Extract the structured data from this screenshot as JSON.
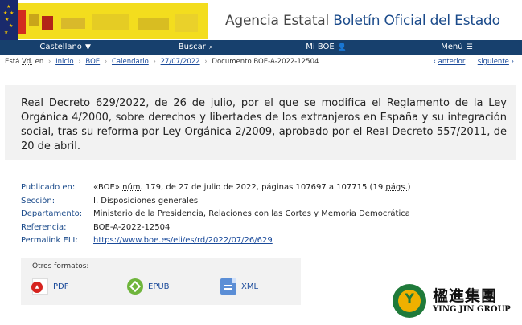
{
  "header": {
    "title_plain": "Agencia Estatal",
    "title_accent": "Boletín Oficial del Estado"
  },
  "nav": {
    "items": [
      {
        "label": "Castellano",
        "icon": "chevron-down-icon",
        "glyph": "▼"
      },
      {
        "label": "Buscar",
        "icon": "search-icon",
        "glyph": "⌕"
      },
      {
        "label": "Mi BOE",
        "icon": "user-icon",
        "glyph": "👤"
      },
      {
        "label": "Menú",
        "icon": "menu-icon",
        "glyph": "☰"
      }
    ]
  },
  "breadcrumb": {
    "prefix": "Está",
    "prefix_abbr": "Vd.",
    "prefix_suffix": "en",
    "items": [
      "Inicio",
      "BOE",
      "Calendario",
      "27/07/2022"
    ],
    "current": "Documento BOE-A-2022-12504",
    "separator": "›"
  },
  "pager": {
    "prev_glyph": "‹",
    "prev": "anterior",
    "next": "siguiente",
    "next_glyph": "›"
  },
  "document": {
    "title": "Real Decreto 629/2022, de 26 de julio, por el que se modifica el Reglamento de la Ley Orgánica 4/2000, sobre derechos y libertades de los extranjeros en España y su integración social, tras su reforma por Ley Orgánica 2/2009, aprobado por el Real Decreto 557/2011, de 20 de abril."
  },
  "metadata": {
    "published_label": "Publicado en:",
    "published_boe": "«BOE»",
    "published_num_abbr": "núm.",
    "published_rest": "179, de 27 de julio de 2022, páginas 107697 a 107715 (19",
    "published_pags_abbr": "págs.",
    "published_close": ")",
    "section_label": "Sección:",
    "section_value": "I. Disposiciones generales",
    "department_label": "Departamento:",
    "department_value": "Ministerio de la Presidencia, Relaciones con las Cortes y Memoria Democrática",
    "reference_label": "Referencia:",
    "reference_value": "BOE-A-2022-12504",
    "permalink_label": "Permalink ELI:",
    "permalink_value": "https://www.boe.es/eli/es/rd/2022/07/26/629"
  },
  "formats": {
    "heading": "Otros formatos:",
    "items": [
      {
        "label": "PDF",
        "icon": "pdf-icon"
      },
      {
        "label": "EPUB",
        "icon": "epub-icon"
      },
      {
        "label": "XML",
        "icon": "xml-icon"
      }
    ]
  },
  "watermark": {
    "glyph": "Y",
    "cn": "楹進集團",
    "en": "YING JIN GROUP"
  }
}
